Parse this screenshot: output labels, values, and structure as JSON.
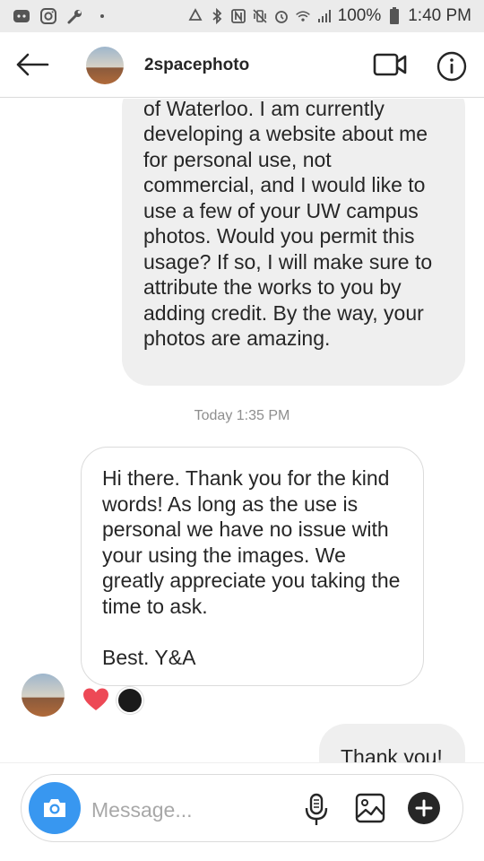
{
  "status_bar": {
    "battery_percent": "100%",
    "time": "1:40 PM",
    "left_icons": [
      "discord-icon",
      "instagram-icon",
      "wrench-icon",
      "dot-icon"
    ],
    "right_icons": [
      "recycle-icon",
      "bluetooth-icon",
      "nfc-icon",
      "vibrate-icon",
      "alarm-icon",
      "wifi-icon",
      "signal-icon",
      "battery-icon"
    ]
  },
  "header": {
    "username": "2spacephoto",
    "icons": [
      "back-arrow-icon",
      "video-call-icon",
      "info-icon"
    ]
  },
  "chat": {
    "sent_message_top": "Hi, I am a student at University of Waterloo. I am currently developing a website about me for personal use, not commercial, and I would like to use a few of your UW campus photos. Would you permit this usage? If so, I will make sure to attribute the works to you by adding credit. By the way, your photos are amazing.",
    "timestamp": "Today 1:35 PM",
    "received_message_body": "Hi there. Thank you for the kind words! As long as the use is personal we have no issue with your using the images. We greatly appreciate you taking the time to ask.",
    "received_message_signoff": "Best. Y&A",
    "reaction": "heart-icon",
    "sent_message_bottom": "Thank you!"
  },
  "composer": {
    "placeholder": "Message...",
    "value": "",
    "icons": [
      "camera-icon",
      "microphone-icon",
      "gallery-icon",
      "plus-icon"
    ]
  },
  "colors": {
    "accent_blue": "#3897f0",
    "heart_red": "#ed4956",
    "bubble_gray": "#efefef",
    "border": "#dbdbdb",
    "muted_text": "#8e8e8e"
  }
}
